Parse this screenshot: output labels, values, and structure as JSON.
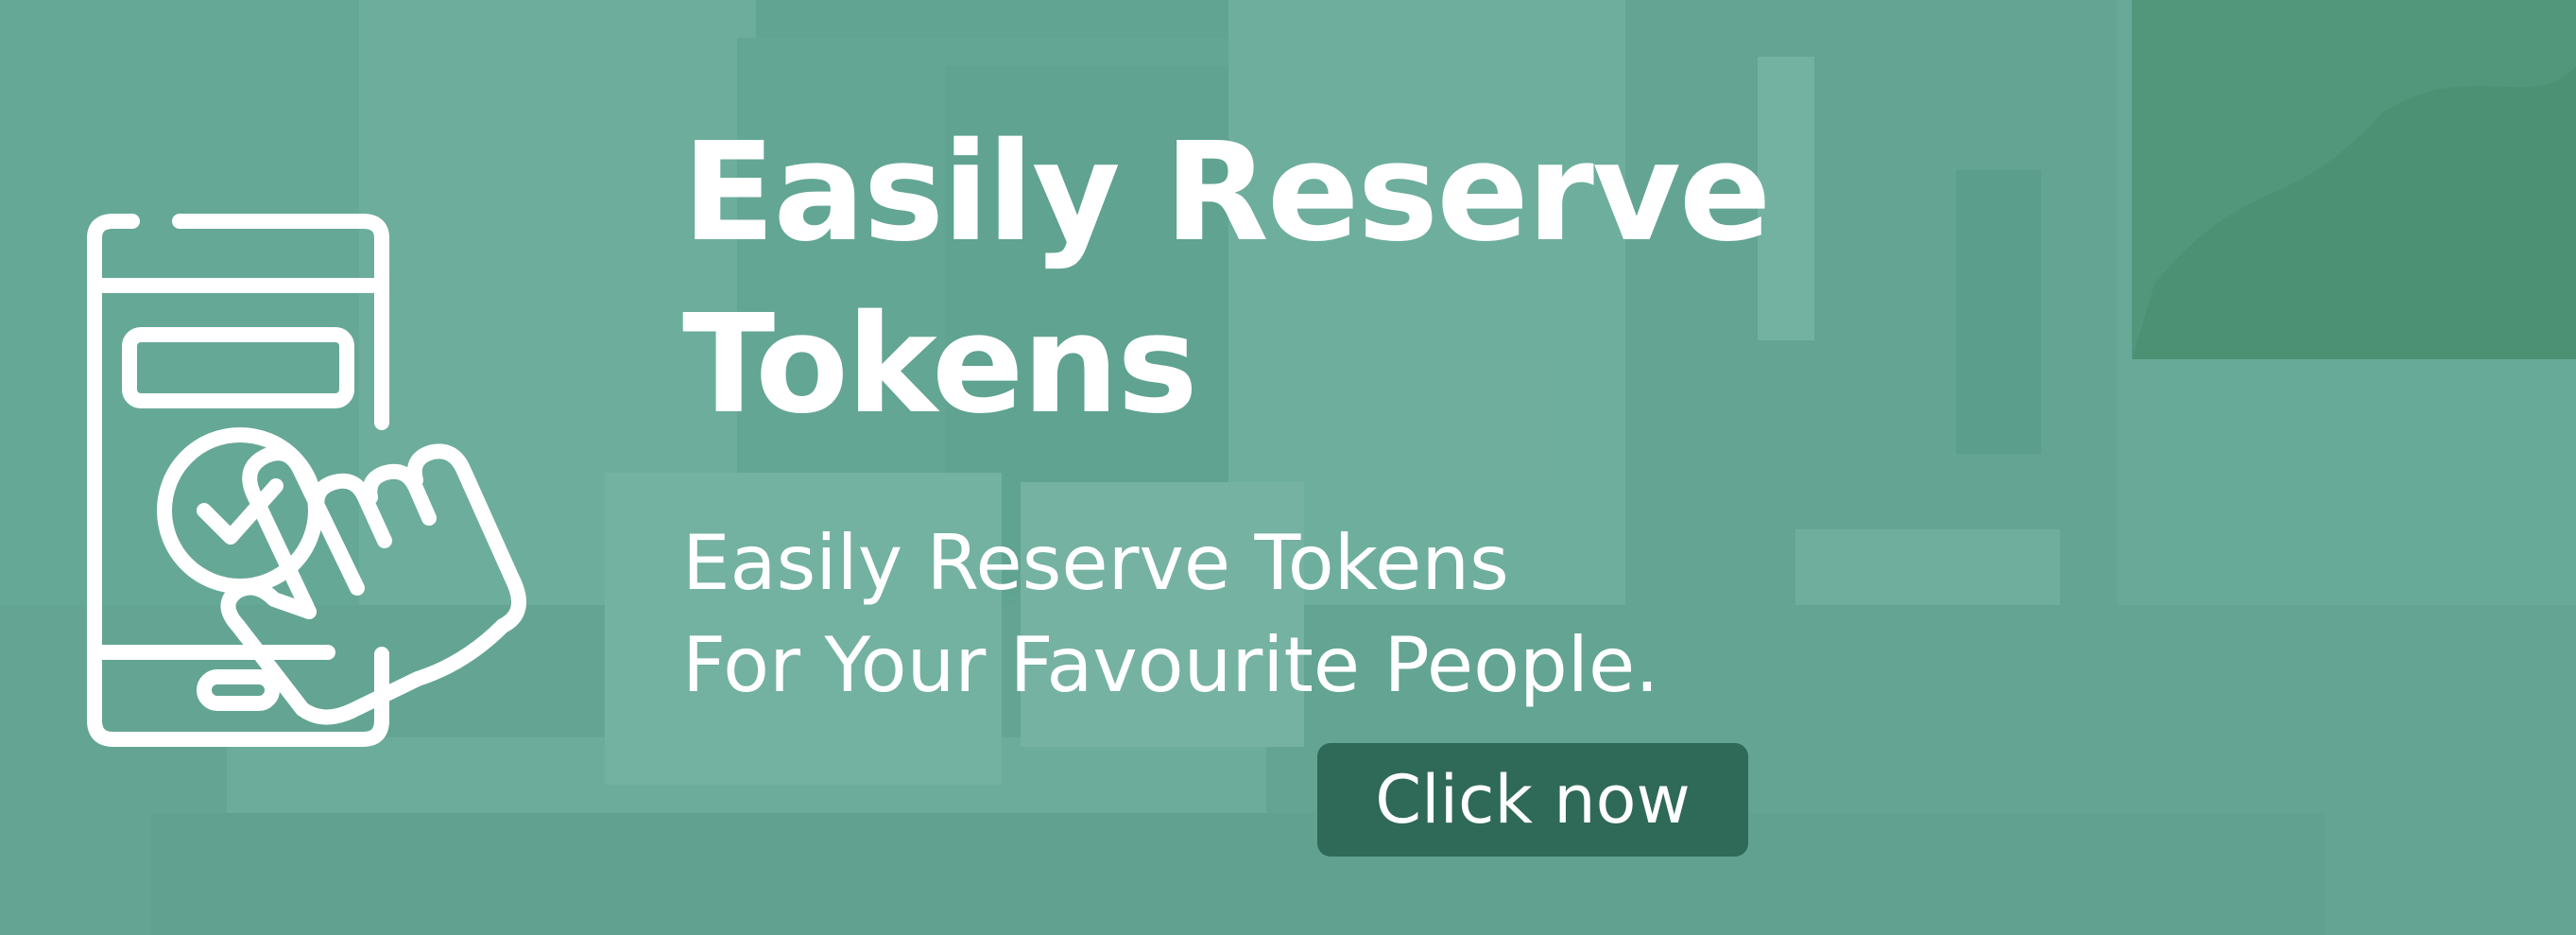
{
  "banner": {
    "headline": "Easily Reserve Tokens",
    "subtitle_line_1": "Easily Reserve Tokens",
    "subtitle_line_2": "For Your Favourite People.",
    "cta_label": "Click now"
  },
  "icons": {
    "main": "smartphone-touch-check-icon"
  },
  "colors": {
    "overlay": "#5f9e8c",
    "button": "#2f6957",
    "text": "#ffffff"
  }
}
